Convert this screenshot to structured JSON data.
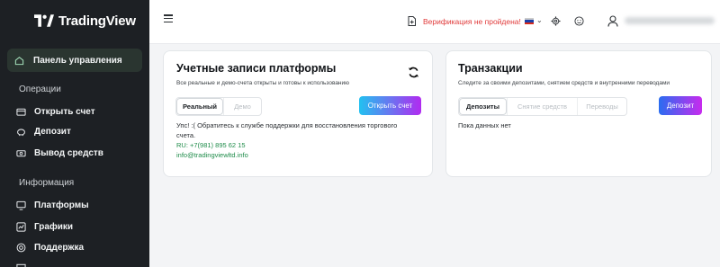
{
  "brand": {
    "name": "TradingView"
  },
  "sidebar": {
    "active": {
      "label": "Панель управления",
      "icon": "home-icon"
    },
    "sections": [
      {
        "title": "Операции",
        "items": [
          {
            "label": "Открыть счет",
            "icon": "wallet-icon"
          },
          {
            "label": "Депозит",
            "icon": "piggy-bank-icon"
          },
          {
            "label": "Вывод средств",
            "icon": "cash-icon"
          }
        ]
      },
      {
        "title": "Информация",
        "items": [
          {
            "label": "Платформы",
            "icon": "monitor-icon"
          },
          {
            "label": "Графики",
            "icon": "chart-icon"
          },
          {
            "label": "Поддержка",
            "icon": "support-icon"
          }
        ]
      }
    ]
  },
  "header": {
    "verification": "Верификация не пройдена!",
    "colors": {
      "alert": "#e03a3a"
    }
  },
  "accounts": {
    "title": "Учетные записи платформы",
    "subtitle": "Все реальные и демо-счета открыты и готовы к использованию",
    "tabs": [
      "Реальный",
      "Демо"
    ],
    "open_button": "Открыть счет",
    "message": "Упс! :( Обратитесь к службе поддержки для восстановления торгового счета.",
    "phone": "RU: +7(981) 895 62 15",
    "email": "info@tradingviewltd.info"
  },
  "transactions": {
    "title": "Транзакции",
    "subtitle": "Следите за своими депозитами, снятием средств и внутренними переводами",
    "tabs": [
      "Депозиты",
      "Снятие средств",
      "Переводы"
    ],
    "deposit_button": "Депозит",
    "empty": "Пока данных нет"
  }
}
